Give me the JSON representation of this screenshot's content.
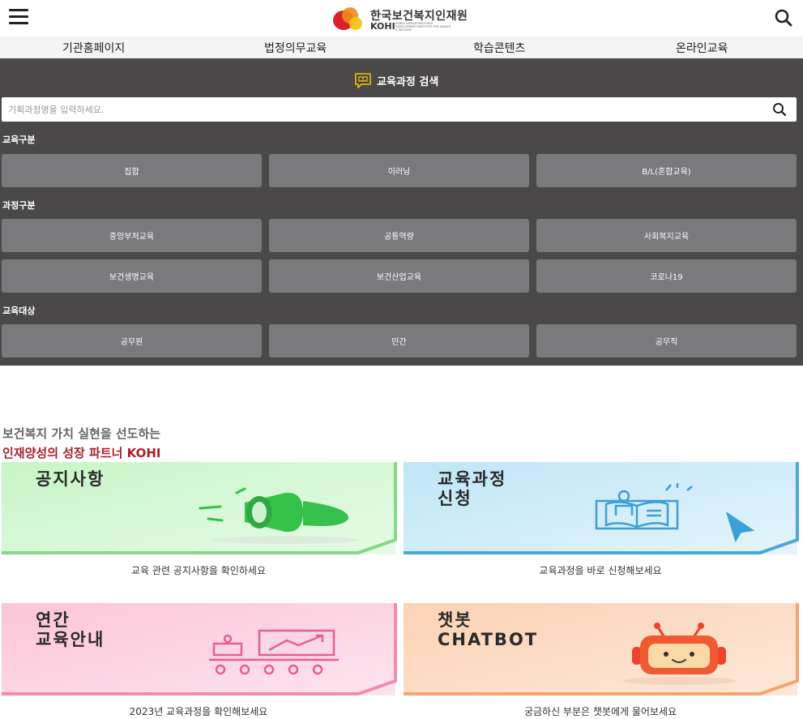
{
  "header": {
    "logo_kr": "한국보건복지인재원",
    "logo_en": "KOHI",
    "logo_sub": "KOREA HUMAN RESOURCE DEVELOPMENT INSTITUTE FOR HEALTH & WELFARE",
    "menu_icon": "hamburger-menu-icon",
    "search_icon": "search-icon"
  },
  "nav": {
    "items": [
      {
        "label": "기관홈페이지"
      },
      {
        "label": "법정의무교육"
      },
      {
        "label": "학습콘텐츠"
      },
      {
        "label": "온라인교육"
      }
    ]
  },
  "search_panel": {
    "title": "교육과정 검색",
    "placeholder": "기획과정명을 입력하세요.",
    "groups": [
      {
        "label": "교육구분",
        "options": [
          "집합",
          "이러닝",
          "B/L(혼합교육)"
        ]
      },
      {
        "label": "과정구분",
        "options": [
          "중앙부처교육",
          "공통역량",
          "사회복지교육",
          "보건생명교육",
          "보건산업교육",
          "코로나19"
        ]
      },
      {
        "label": "교육대상",
        "options": [
          "공무원",
          "민간",
          "공무직"
        ]
      }
    ]
  },
  "intro": {
    "line1": "보건복지 가치 실현을 선도하는",
    "line2": "인재양성의 성장 파트너 KOHI"
  },
  "cards": [
    {
      "title": "공지사항",
      "title2": "",
      "desc": "교육 관련 공지사항을 확인하세요",
      "icon": "megaphone-icon",
      "color": "#7fd67f"
    },
    {
      "title": "교육과정",
      "title2": "신청",
      "desc": "교육과정을 바로 신청해보세요",
      "icon": "open-book-icon",
      "color": "#4aa8d8"
    },
    {
      "title": "연간",
      "title2": "교육안내",
      "desc": "2023년 교육과정을 확인해보세요",
      "icon": "training-room-icon",
      "color": "#f08cb0"
    },
    {
      "title": "챗봇",
      "title2": "CHATBOT",
      "desc": "궁금하신 부분은 챗봇에게 물어보세요",
      "icon": "chatbot-robot-icon",
      "color": "#f5a46f"
    }
  ],
  "colors": {
    "panel_bg": "#4a4849",
    "chip_bg": "#7a797c",
    "accent_red": "#a8232b",
    "nav_bg": "#f3f4f6"
  }
}
